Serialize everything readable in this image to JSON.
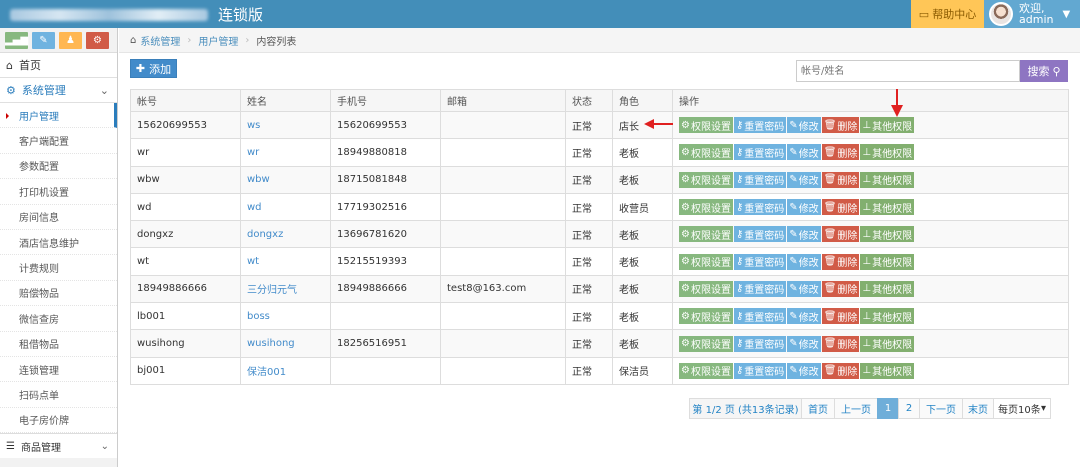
{
  "header": {
    "app_title": "连锁版",
    "help_label": "帮助中心",
    "welcome": "欢迎,",
    "username": "admin"
  },
  "sidebar": {
    "home": "首页",
    "group_label": "系统管理",
    "items": [
      "用户管理",
      "客户端配置",
      "参数配置",
      "打印机设置",
      "房间信息",
      "酒店信息维护",
      "计费规则",
      "赔偿物品",
      "微信查房",
      "租借物品",
      "连锁管理",
      "扫码点单",
      "电子房价牌"
    ],
    "goods": "商品管理"
  },
  "breadcrumb": [
    "系统管理",
    "用户管理",
    "内容列表"
  ],
  "toolbar": {
    "add_label": "添加",
    "search_placeholder": "帐号/姓名",
    "search_label": "搜索"
  },
  "table": {
    "headers": [
      "帐号",
      "姓名",
      "手机号",
      "邮箱",
      "状态",
      "角色",
      "操作"
    ],
    "actions": [
      "权限设置",
      "重置密码",
      "修改",
      "删除",
      "其他权限"
    ],
    "rows": [
      {
        "account": "15620699553",
        "name": "ws",
        "phone": "15620699553",
        "email": "",
        "status": "正常",
        "role": "店长"
      },
      {
        "account": "wr",
        "name": "wr",
        "phone": "18949880818",
        "email": "",
        "status": "正常",
        "role": "老板"
      },
      {
        "account": "wbw",
        "name": "wbw",
        "phone": "18715081848",
        "email": "",
        "status": "正常",
        "role": "老板"
      },
      {
        "account": "wd",
        "name": "wd",
        "phone": "17719302516",
        "email": "",
        "status": "正常",
        "role": "收营员"
      },
      {
        "account": "dongxz",
        "name": "dongxz",
        "phone": "13696781620",
        "email": "",
        "status": "正常",
        "role": "老板"
      },
      {
        "account": "wt",
        "name": "wt",
        "phone": "15215519393",
        "email": "",
        "status": "正常",
        "role": "老板"
      },
      {
        "account": "18949886666",
        "name": "三分归元气",
        "phone": "18949886666",
        "email": "test8@163.com",
        "status": "正常",
        "role": "老板"
      },
      {
        "account": "lb001",
        "name": "boss",
        "phone": "",
        "email": "",
        "status": "正常",
        "role": "老板"
      },
      {
        "account": "wusihong",
        "name": "wusihong",
        "phone": "18256516951",
        "email": "",
        "status": "正常",
        "role": "老板"
      },
      {
        "account": "bj001",
        "name": "保洁001",
        "phone": "",
        "email": "",
        "status": "正常",
        "role": "保洁员"
      }
    ]
  },
  "pagination": {
    "info": "第 1/2 页 (共13条记录)",
    "first": "首页",
    "prev": "上一页",
    "pages": [
      "1",
      "2"
    ],
    "next": "下一页",
    "last": "末页",
    "page_size": "每页10条"
  },
  "colors": {
    "topbar": "#438eb9",
    "help": "#ffc657",
    "search_button": "#8e75c2",
    "annotation_arrow": "#e02020"
  }
}
